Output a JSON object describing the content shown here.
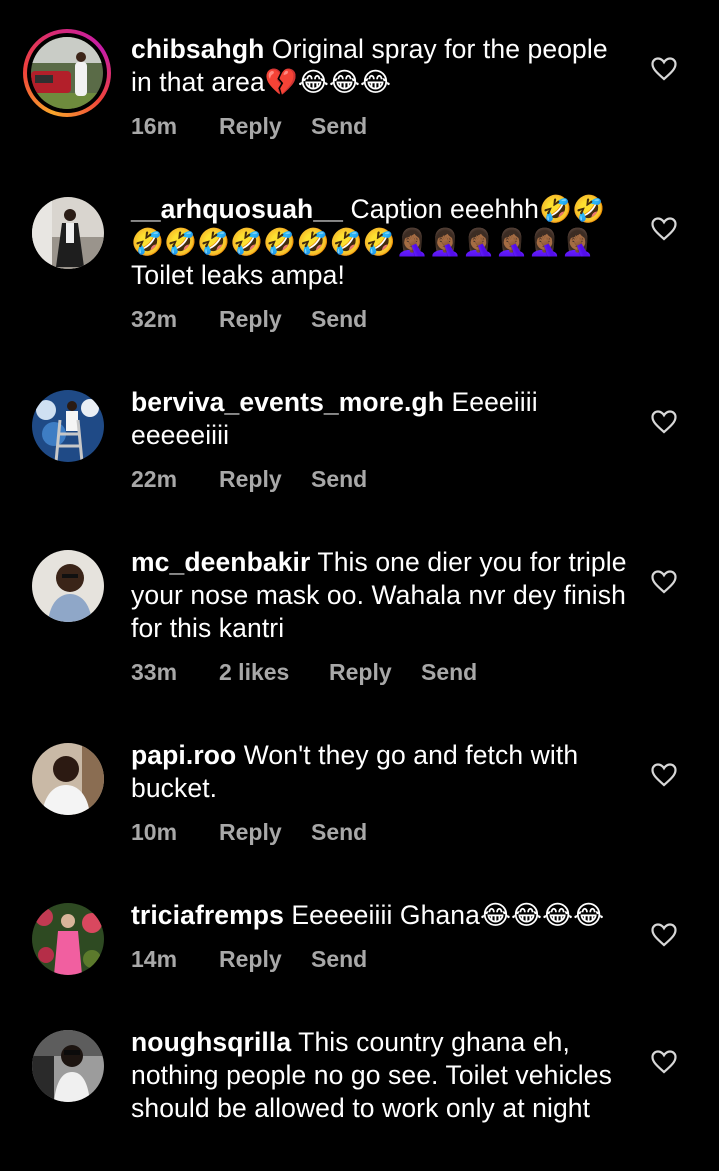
{
  "comments": [
    {
      "username": "chibsahgh",
      "text": " Original spray for the people in that area💔😂😂😂",
      "time": "16m",
      "likes": "",
      "reply_label": "Reply",
      "send_label": "Send"
    },
    {
      "username": "__arhquosuah__",
      "text": " Caption eeehhh🤣🤣🤣🤣🤣🤣🤣🤣🤣🤣🤦🏾‍♀️🤦🏾‍♀️🤦🏾‍♀️🤦🏾‍♀️🤦🏾‍♀️🤦🏾‍♀️ Toilet leaks ampa!",
      "time": "32m",
      "likes": "",
      "reply_label": "Reply",
      "send_label": "Send"
    },
    {
      "username": "berviva_events_more.gh",
      "text": " Eeeeiiii eeeeeiiii",
      "time": "22m",
      "likes": "",
      "reply_label": "Reply",
      "send_label": "Send"
    },
    {
      "username": "mc_deenbakir",
      "text": " This one dier you for triple your nose mask oo. Wahala nvr dey finish for this kantri",
      "time": "33m",
      "likes": "2 likes",
      "reply_label": "Reply",
      "send_label": "Send"
    },
    {
      "username": "papi.roo",
      "text": " Won't they go and fetch with bucket.",
      "time": "10m",
      "likes": "",
      "reply_label": "Reply",
      "send_label": "Send"
    },
    {
      "username": "triciafremps",
      "text": " Eeeeeiiii Ghana😂😂😂😂",
      "time": "14m",
      "likes": "",
      "reply_label": "Reply",
      "send_label": "Send"
    },
    {
      "username": "noughsqrilla",
      "text": " This country ghana eh, nothing people no go see. Toilet vehicles should be allowed to work only at night",
      "time": "",
      "likes": "",
      "reply_label": "",
      "send_label": ""
    }
  ],
  "colors": {
    "background": "#000000",
    "text": "#ffffff",
    "meta": "#a8a8a8",
    "story_ring": [
      "#f9a62b",
      "#d62976",
      "#c71da8"
    ]
  },
  "icons": {
    "like": "heart-outline-icon"
  }
}
